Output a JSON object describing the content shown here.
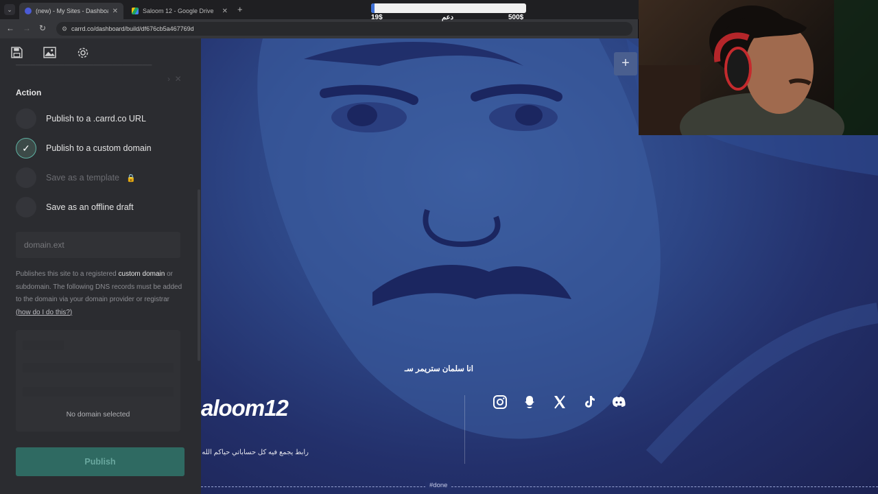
{
  "browser": {
    "tabs": [
      {
        "title": "(new) - My Sites - Dashboard ·",
        "active": true
      },
      {
        "title": "Saloom 12 - Google Drive",
        "active": false
      }
    ],
    "url": "carrd.co/dashboard/build/df676cb5a467769d"
  },
  "donation_goal": {
    "min_label": "19$",
    "center_label": "دعم",
    "max_label": "500$",
    "progress_fraction": 0.02
  },
  "panel": {
    "section_title": "Action",
    "options": [
      {
        "label": "Publish to a .carrd.co URL",
        "checked": false,
        "disabled": false
      },
      {
        "label": "Publish to a custom domain",
        "checked": true,
        "disabled": false
      },
      {
        "label": "Save as a template",
        "checked": false,
        "disabled": true
      },
      {
        "label": "Save as an offline draft",
        "checked": false,
        "disabled": false
      }
    ],
    "domain_placeholder": "domain.ext",
    "description": {
      "part1": "Publishes this site to a registered ",
      "bold": "custom domain",
      "part2": " or subdomain. The following DNS records must be added to the domain via your domain provider or registrar ",
      "link": "(how do I do this?)"
    },
    "dns_message": "No domain selected",
    "publish_label": "Publish"
  },
  "canvas": {
    "arabic_title": "انا سلمان ستريمر سـ",
    "brand": "aloom12",
    "arabic_subtitle": "رابط يجمع فيه كل حساباتي حياكم الله",
    "done_tag": "#done",
    "social_icons": [
      "instagram-icon",
      "snapchat-icon",
      "x-icon",
      "tiktok-icon",
      "discord-icon"
    ]
  }
}
